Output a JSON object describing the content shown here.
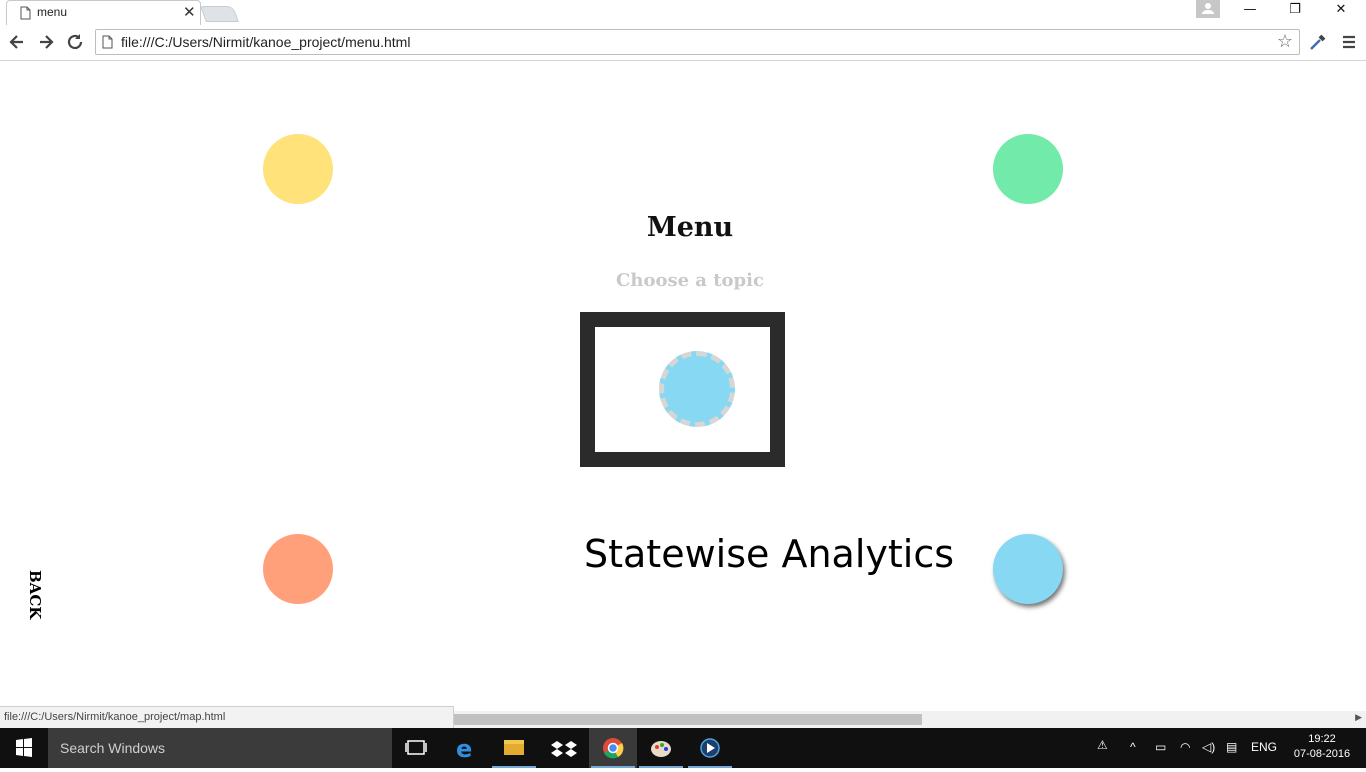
{
  "browser": {
    "tab_title": "menu",
    "tab_close": "✕",
    "address": "file:///C:/Users/Nirmit/kanoe_project/menu.html",
    "status_url": "file:///C:/Users/Nirmit/kanoe_project/map.html",
    "window_controls": {
      "minimize": "—",
      "restore": "❐",
      "close": "✕"
    }
  },
  "page": {
    "title": "Menu",
    "subtitle": "Choose a topic",
    "topic_label": "Statewise Analytics",
    "back_label": "BACK",
    "colors": {
      "yellow": "#ffe27a",
      "green": "#72eaaa",
      "orange": "#ffa07a",
      "blue": "#87d8f2",
      "frame": "#2b2b2b"
    }
  },
  "taskbar": {
    "search_placeholder": "Search Windows",
    "language": "ENG",
    "time": "19:22",
    "date": "07-08-2016",
    "apps": [
      "task-view-icon",
      "edge-icon",
      "file-explorer-icon",
      "dropbox-icon",
      "chrome-icon",
      "paint-icon",
      "media-player-icon"
    ]
  }
}
